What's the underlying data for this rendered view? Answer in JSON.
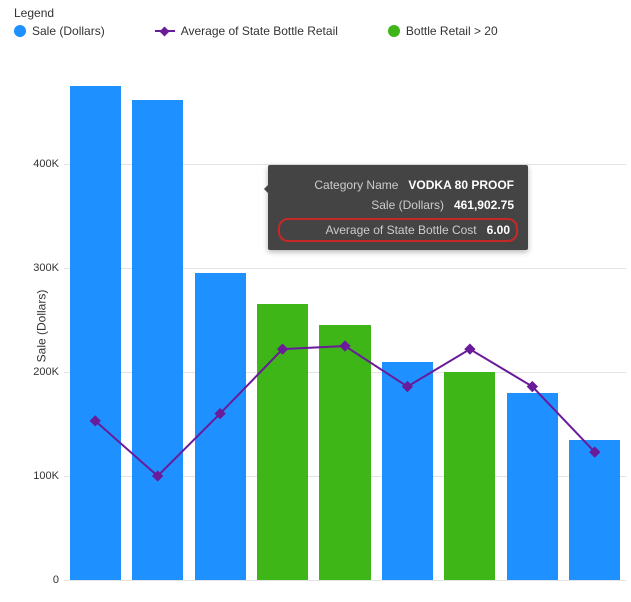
{
  "legend": {
    "title": "Legend",
    "items": [
      {
        "label": "Sale (Dollars)",
        "color": "#1e90ff",
        "shape": "circle"
      },
      {
        "label": "Average of State Bottle Retail",
        "color": "#6a1b9a",
        "shape": "line"
      },
      {
        "label": "Bottle Retail > 20",
        "color": "#3fb618",
        "shape": "circle"
      }
    ]
  },
  "ylabel": "Sale (Dollars)",
  "yticks": [
    "0",
    "100K",
    "200K",
    "300K",
    "400K"
  ],
  "tooltip": {
    "rows": [
      {
        "label": "Category Name",
        "value": "VODKA 80 PROOF"
      },
      {
        "label": "Sale (Dollars)",
        "value": "461,902.75"
      }
    ],
    "highlight": {
      "label": "Average of State Bottle Cost",
      "value": "6.00"
    }
  },
  "chart_data": {
    "type": "bar+line",
    "ylabel": "Sale (Dollars)",
    "ylim": [
      0,
      500000
    ],
    "yticks": [
      0,
      100000,
      200000,
      300000,
      400000
    ],
    "series": [
      {
        "name": "Sale (Dollars) bars",
        "type": "bar",
        "values": [
          475000,
          461903,
          295000,
          265000,
          245000,
          210000,
          200000,
          180000,
          135000
        ],
        "retail_gt_20": [
          false,
          false,
          false,
          true,
          true,
          false,
          true,
          false,
          false
        ],
        "colors_note": "blue when Bottle Retail <= 20, green when > 20"
      },
      {
        "name": "Average of State Bottle Retail",
        "type": "line",
        "values_relative_to_left_axis": [
          153000,
          100000,
          160000,
          222000,
          225000,
          186000,
          222000,
          186000,
          123000
        ],
        "note": "line is on a secondary/unknown scale; values approximated to visual position against left axis"
      }
    ],
    "highlighted_point": {
      "index": 1,
      "category_name": "VODKA 80 PROOF",
      "sale_dollars": 461902.75,
      "avg_state_bottle_cost": 6.0
    }
  },
  "colors": {
    "barBlue": "#1e90ff",
    "barGreen": "#3fb618",
    "line": "#6a1b9a"
  }
}
